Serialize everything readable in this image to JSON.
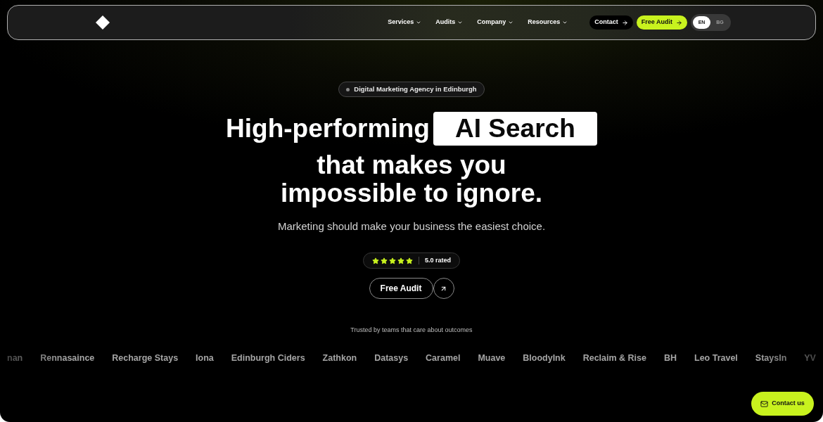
{
  "navbar": {
    "menu": [
      {
        "label": "Services"
      },
      {
        "label": "Audits"
      },
      {
        "label": "Company"
      },
      {
        "label": "Resources"
      }
    ],
    "contact_button": "Contact",
    "audit_button": "Free Audit",
    "languages": [
      {
        "label": "EN",
        "selected": true
      },
      {
        "label": "BG",
        "selected": false
      }
    ]
  },
  "hero": {
    "badge": "Digital Marketing Agency in Edinburgh",
    "headline_start": "High-performing",
    "headline_highlight": "AI Search",
    "headline_lines": [
      "that makes you",
      "impossible to ignore."
    ],
    "subtitle": "Marketing should make your business the easiest choice.",
    "rating": {
      "stars": 5,
      "label": "5.0 rated"
    },
    "cta_button": "Free Audit"
  },
  "trusted": {
    "caption": "Trusted by teams that care about outcomes",
    "logos": [
      "nan",
      "Rennasaince",
      "Recharge Stays",
      "Iona",
      "Edinburgh Ciders",
      "Zathkon",
      "Datasys",
      "Caramel",
      "Muave",
      "BloodyInk",
      "Reclaim & Rise",
      "BH",
      "Leo Travel",
      "StaysIn",
      "YV"
    ]
  },
  "contact_fab": "Contact us"
}
